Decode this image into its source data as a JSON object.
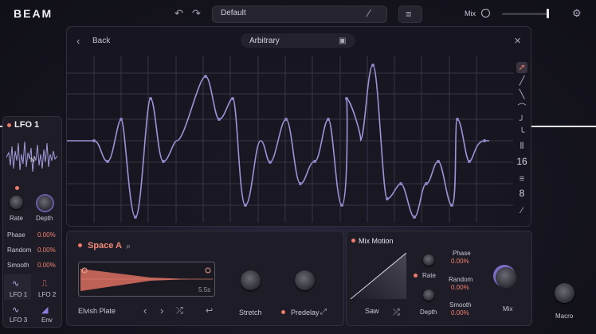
{
  "app": {
    "logo": "BEAM"
  },
  "topbar": {
    "preset_name": "Default",
    "mix_label": "Mix",
    "mix_level": 0.97
  },
  "editor": {
    "back_label": "Back",
    "title": "Arbitrary",
    "tools": {
      "grid_x": "16",
      "grid_y": "8"
    }
  },
  "lfo": {
    "title": "LFO 1",
    "rate_label": "Rate",
    "depth_label": "Depth",
    "params": [
      {
        "label": "Phase",
        "value": "0.00%"
      },
      {
        "label": "Random",
        "value": "0.00%"
      },
      {
        "label": "Smooth",
        "value": "0.00%"
      }
    ],
    "slots": [
      "LFO 1",
      "LFO 2",
      "LFO 3",
      "Env"
    ]
  },
  "space": {
    "title": "Space A",
    "ir_length": "5.5s",
    "ir_name": "Elvish Plate",
    "stretch_label": "Stretch",
    "predelay_label": "Predelay"
  },
  "mix_motion": {
    "title": "Mix Motion",
    "shape_label": "Saw",
    "rate_label": "Rate",
    "depth_label": "Depth",
    "phase_label": "Phase",
    "phase_value": "0.00%",
    "random_label": "Random",
    "random_value": "0.00%",
    "smooth_label": "Smooth",
    "smooth_value": "0.00%",
    "mix_label": "Mix"
  },
  "macro": {
    "label": "Macro"
  },
  "colors": {
    "accent": "#f07a6a",
    "curve": "#9a94d8",
    "grid": "#3a3948"
  }
}
